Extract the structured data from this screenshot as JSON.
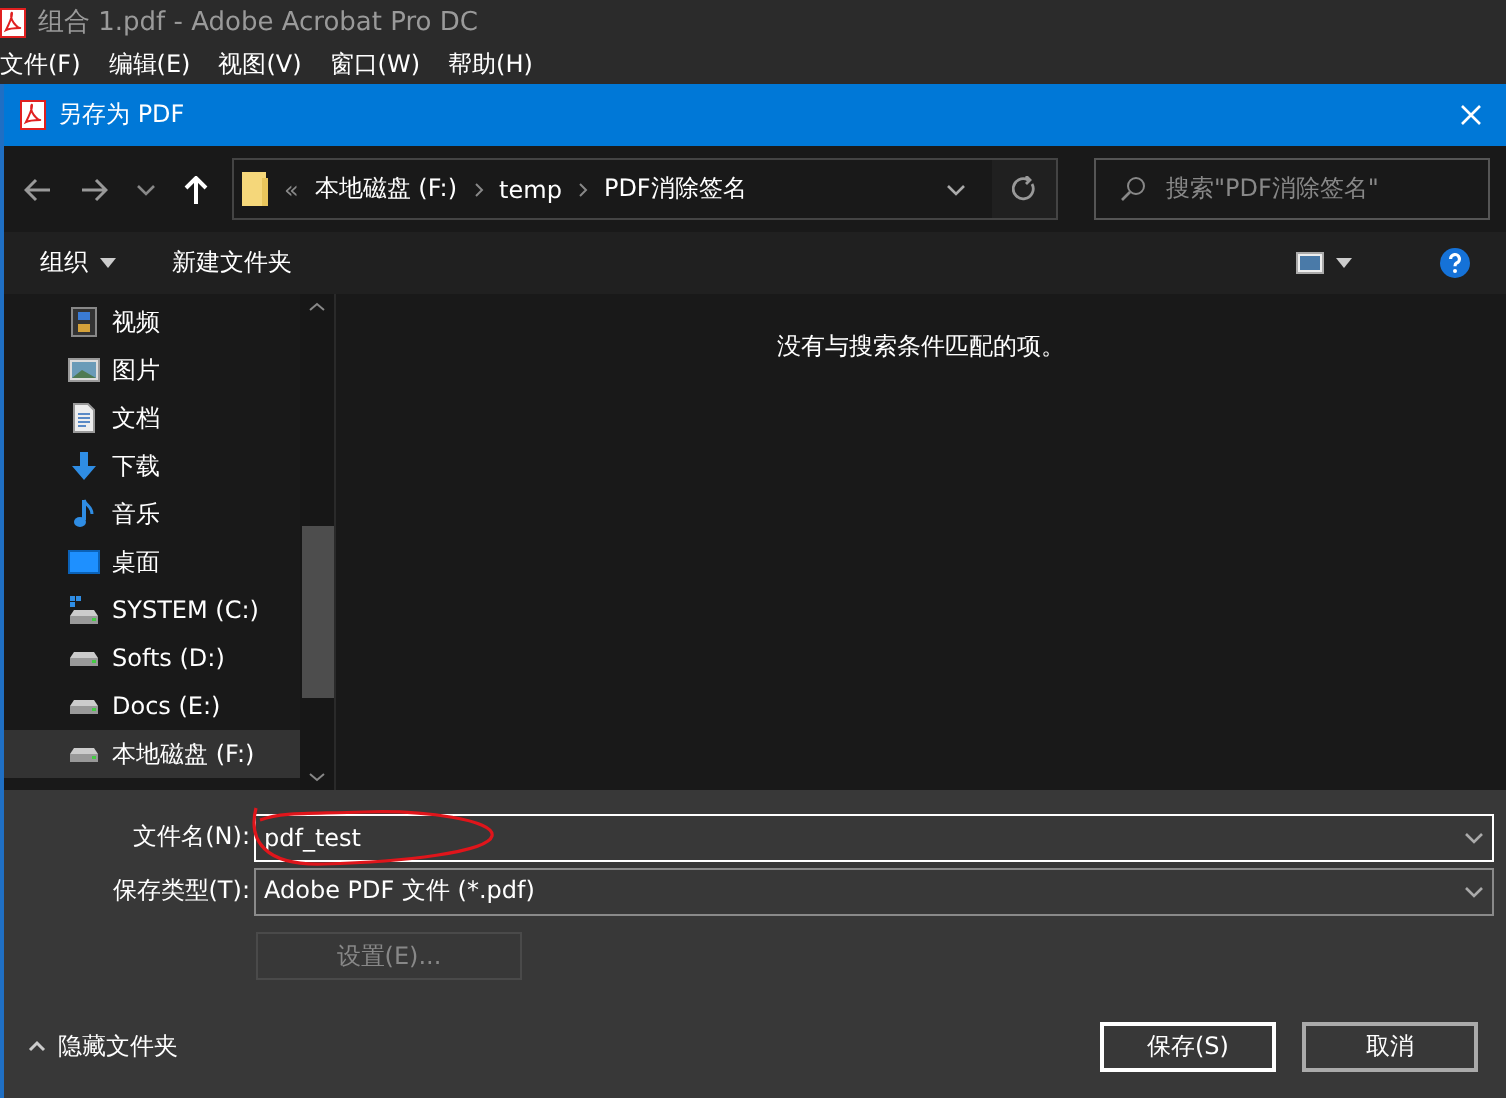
{
  "app": {
    "title": "组合 1.pdf - Adobe Acrobat Pro DC",
    "menu": [
      "文件(F)",
      "编辑(E)",
      "视图(V)",
      "窗口(W)",
      "帮助(H)"
    ]
  },
  "dialog": {
    "title": "另存为 PDF",
    "breadcrumb": {
      "overflow": "«",
      "parts": [
        "本地磁盘 (F:)",
        "temp",
        "PDF消除签名"
      ]
    },
    "search": {
      "placeholder": "搜索\"PDF消除签名\""
    },
    "toolbar": {
      "organize": "组织",
      "new_folder": "新建文件夹"
    },
    "nav_items": [
      {
        "label": "视频",
        "kind": "video",
        "selected": false
      },
      {
        "label": "图片",
        "kind": "picture",
        "selected": false
      },
      {
        "label": "文档",
        "kind": "document",
        "selected": false
      },
      {
        "label": "下载",
        "kind": "download",
        "selected": false
      },
      {
        "label": "音乐",
        "kind": "music",
        "selected": false
      },
      {
        "label": "桌面",
        "kind": "desktop",
        "selected": false
      },
      {
        "label": "SYSTEM (C:)",
        "kind": "system-drive",
        "selected": false
      },
      {
        "label": "Softs (D:)",
        "kind": "drive",
        "selected": false
      },
      {
        "label": "Docs (E:)",
        "kind": "drive",
        "selected": false
      },
      {
        "label": "本地磁盘 (F:)",
        "kind": "drive",
        "selected": true
      }
    ],
    "empty_message": "没有与搜索条件匹配的项。",
    "file_name": {
      "label": "文件名(N):",
      "value": "pdf_test",
      "annotated": true
    },
    "file_type": {
      "label": "保存类型(T):",
      "value": "Adobe PDF 文件 (*.pdf)"
    },
    "settings_button": {
      "label": "设置(E)...",
      "disabled": true
    },
    "hide_folders": "隐藏文件夹",
    "buttons": [
      "保存(S)",
      "取消"
    ]
  }
}
